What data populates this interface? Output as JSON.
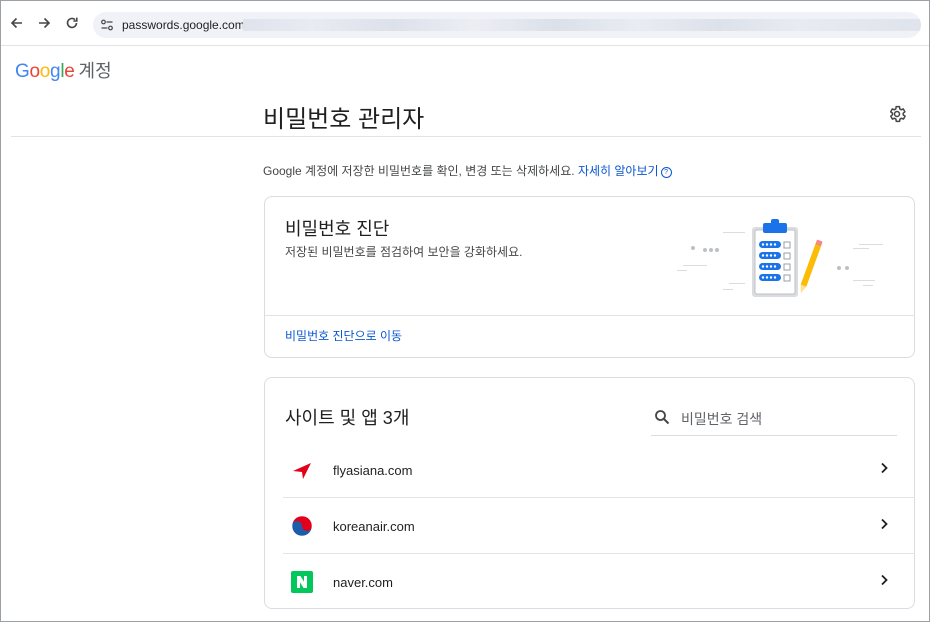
{
  "browser": {
    "url": "passwords.google.com/"
  },
  "account": {
    "logo_text": "Google",
    "label": "계정"
  },
  "page": {
    "title": "비밀번호 관리자",
    "description": "Google 계정에 저장한 비밀번호를 확인, 변경 또는 삭제하세요.",
    "learn_more": "자세히 알아보기",
    "help_glyph": "?"
  },
  "checkup": {
    "title": "비밀번호 진단",
    "subtitle": "저장된 비밀번호를 점검하여 보안을 강화하세요.",
    "link": "비밀번호 진단으로 이동"
  },
  "sites": {
    "title": "사이트 및 앱 3개",
    "search_placeholder": "비밀번호 검색",
    "items": [
      {
        "name": "flyasiana.com",
        "icon": "asiana-logo-icon"
      },
      {
        "name": "koreanair.com",
        "icon": "koreanair-logo-icon"
      },
      {
        "name": "naver.com",
        "icon": "naver-logo-icon"
      }
    ]
  },
  "colors": {
    "link_blue": "#0b57d0",
    "naver_green": "#03c75a",
    "asiana_red": "#e2001a",
    "korean_air_blue": "#1d5ca8"
  }
}
